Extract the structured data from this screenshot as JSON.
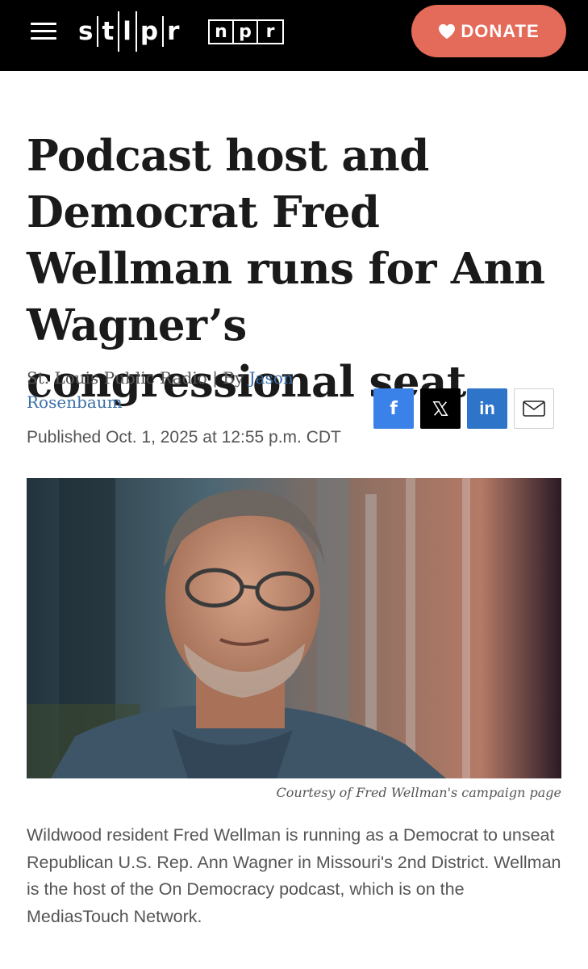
{
  "header": {
    "logo_stlpr": [
      "s",
      "t",
      "l",
      "p",
      "r"
    ],
    "logo_npr": [
      "n",
      "p",
      "r"
    ],
    "donate_label": "DONATE"
  },
  "article": {
    "headline": "Podcast host and Democrat Fred Wellman runs for Ann Wagner’s congressional seat",
    "byline_source": "St. Louis Public Radio | By ",
    "byline_author": "Jason Rosenbaum",
    "published": "Published Oct. 1, 2025 at 12:55 p.m. CDT",
    "image_caption": "Courtesy of Fred Wellman's campaign page",
    "lead_paragraph": "Wildwood resident Fred Wellman is running as a Democrat to unseat Republican U.S. Rep. Ann Wagner in Missouri's 2nd District. Wellman is the host of the On Democracy podcast, which is on the MediasTouch Network."
  },
  "share": {
    "facebook_glyph": "f",
    "linkedin_glyph": "in",
    "icons": [
      "facebook-icon",
      "x-icon",
      "linkedin-icon",
      "email-icon"
    ]
  },
  "colors": {
    "topbar": "#000000",
    "donate": "#e46b59",
    "link": "#3a6fa8",
    "facebook": "#3b82e8",
    "linkedin": "#2e74c8"
  }
}
